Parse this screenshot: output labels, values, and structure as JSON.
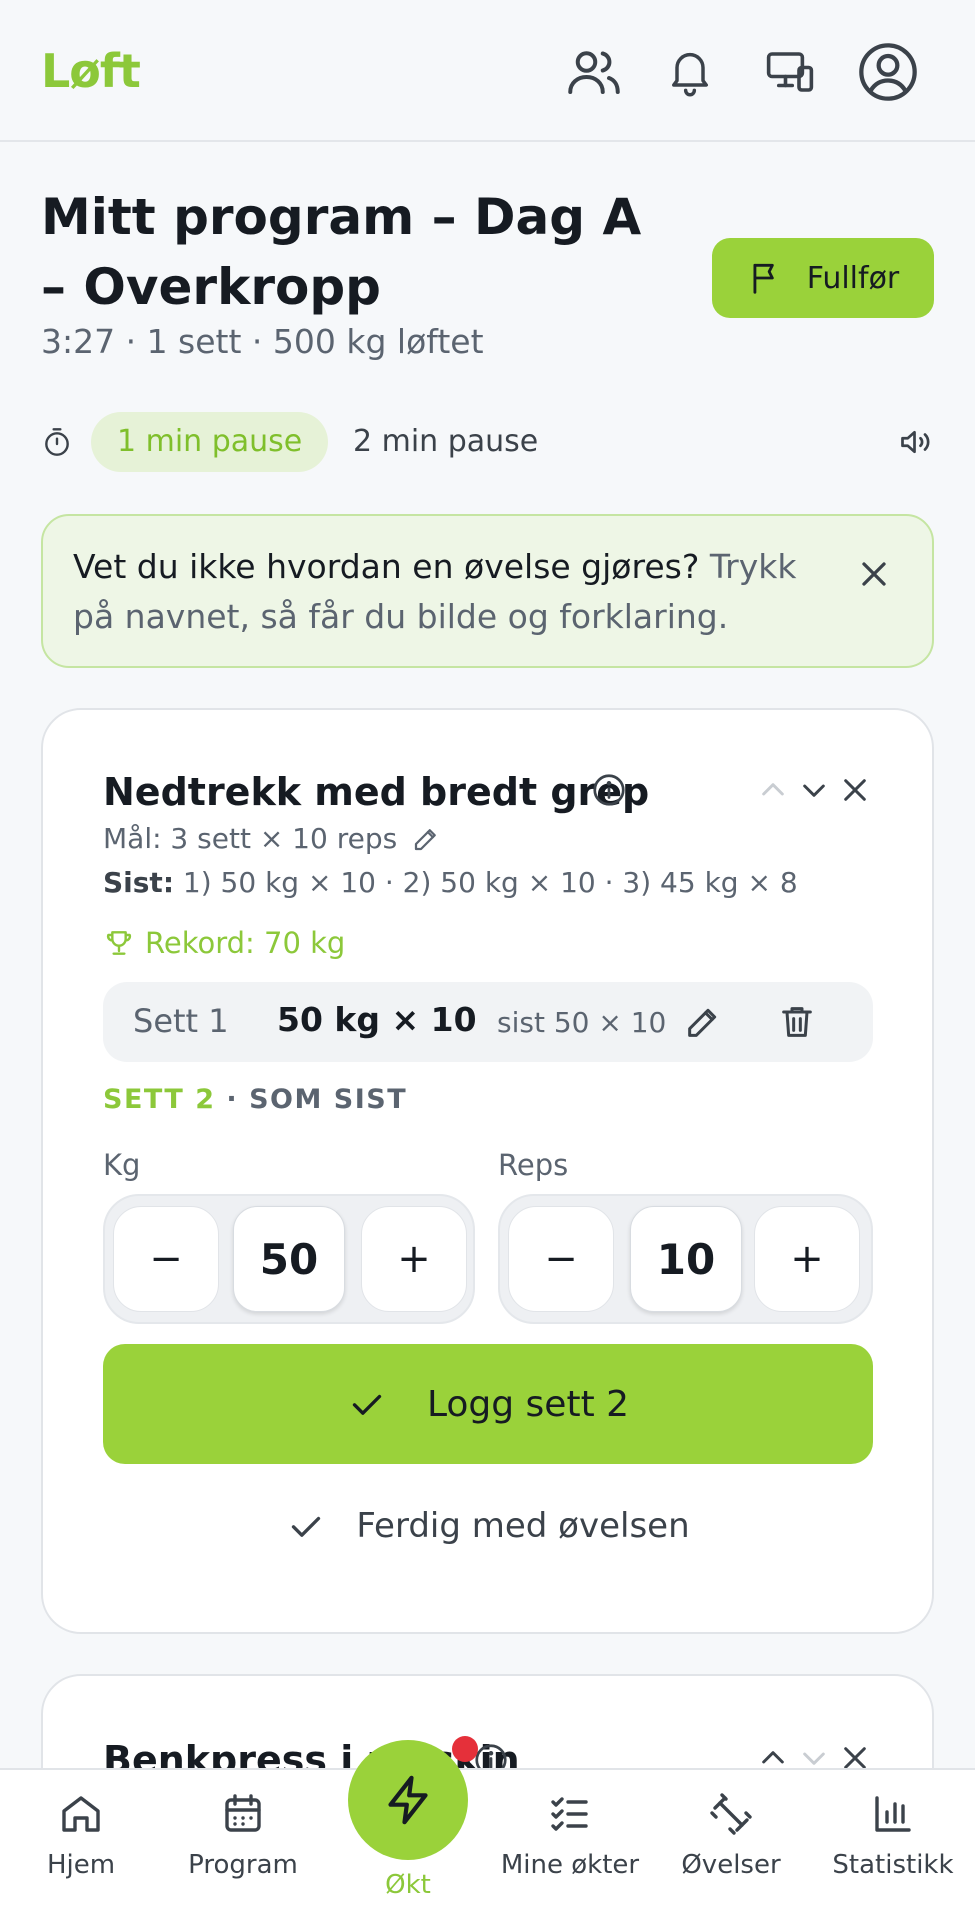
{
  "header": {
    "logo": "Løft"
  },
  "session": {
    "title": "Mitt program – Dag A – Overkropp",
    "stats": "3:27 · 1 sett · 500 kg løftet",
    "finish_label": "Fullfør"
  },
  "pause": {
    "options": [
      "1 min pause",
      "2 min pause"
    ],
    "active_index": 0
  },
  "tip": {
    "strong": "Vet du ikke hvordan en øvelse gjøres?",
    "rest": " Trykk på navnet, så får du bilde og forklaring."
  },
  "exercise": {
    "name": "Nedtrekk med bredt grep",
    "goal": "Mål: 3 sett × 10 reps",
    "last_label": "Sist:",
    "last_value": " 1) 50 kg × 10 · 2) 50 kg × 10 · 3) 45 kg × 8",
    "record": "Rekord: 70 kg",
    "done_sets": [
      {
        "label": "Sett 1",
        "value": "50 kg × 10",
        "last": "sist 50 × 10"
      }
    ],
    "next_set_label": "SETT 2",
    "next_set_hint": " · SOM SIST",
    "kg_label": "Kg",
    "kg_value": "50",
    "reps_label": "Reps",
    "reps_value": "10",
    "minus": "−",
    "plus": "+",
    "log_label": "Logg sett 2",
    "done_label": "Ferdig med øvelsen"
  },
  "next_exercise": {
    "name": "Benkpress i maskin"
  },
  "nav": {
    "items": [
      "Hjem",
      "Program",
      "Økt",
      "Mine økter",
      "Øvelser",
      "Statistikk"
    ],
    "active": "Økt"
  },
  "colors": {
    "accent": "#9ad23a",
    "accent_text": "#8cc83a",
    "notification": "#e5303a"
  }
}
